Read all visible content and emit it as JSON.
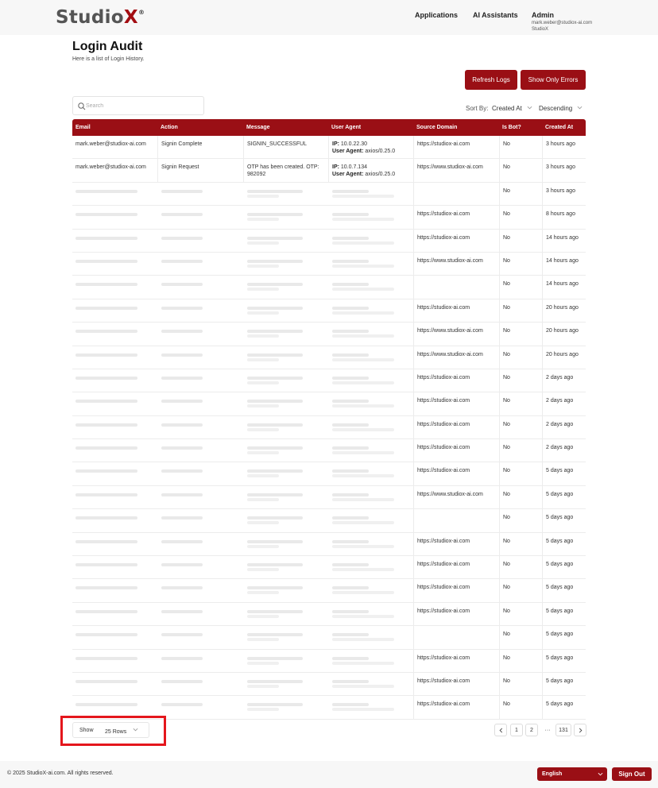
{
  "header": {
    "logo_main": "Studio",
    "logo_accent": "X",
    "logo_mark": "®",
    "nav": [
      {
        "label": "Applications"
      },
      {
        "label": "AI Assistants"
      }
    ],
    "user": {
      "name": "Admin",
      "email": "mark.weber@studiox-ai.com",
      "org": "StudioX"
    }
  },
  "page": {
    "title": "Login Audit",
    "subtitle": "Here is a list of Login History."
  },
  "toolbar": {
    "refresh_label": "Refresh Logs",
    "errors_label": "Show Only Errors",
    "search_placeholder": "Search",
    "sort_by_label": "Sort By:",
    "sort_field": "Created At",
    "sort_direction": "Descending"
  },
  "table": {
    "columns": [
      "Email",
      "Action",
      "Message",
      "User Agent",
      "Source Domain",
      "Is Bot?",
      "Created At"
    ],
    "rows": [
      {
        "email": "mark.weber@studiox-ai.com",
        "action": "Signin Complete",
        "message": "SIGNIN_SUCCESSFUL",
        "ip_label": "IP:",
        "ip": " 10.0.22.30",
        "ua_label": "User Agent:",
        "ua": " axios/0.25.0",
        "domain": "https://studiox-ai.com",
        "bot": "No",
        "created": "3 hours ago",
        "blurred": false
      },
      {
        "email": "mark.weber@studiox-ai.com",
        "action": "Signin Request",
        "message": "OTP has been created. OTP: 982092",
        "ip_label": "IP:",
        "ip": " 10.0.7.134",
        "ua_label": "User Agent:",
        "ua": " axios/0.25.0",
        "domain": "https://www.studiox-ai.com",
        "bot": "No",
        "created": "3 hours ago",
        "blurred": false
      },
      {
        "domain": "",
        "bot": "No",
        "created": "3 hours ago",
        "blurred": true
      },
      {
        "domain": "https://studiox-ai.com",
        "bot": "No",
        "created": "8 hours ago",
        "blurred": true
      },
      {
        "domain": "https://studiox-ai.com",
        "bot": "No",
        "created": "14 hours ago",
        "blurred": true
      },
      {
        "domain": "https://www.studiox-ai.com",
        "bot": "No",
        "created": "14 hours ago",
        "blurred": true
      },
      {
        "domain": "",
        "bot": "No",
        "created": "14 hours ago",
        "blurred": true
      },
      {
        "domain": "https://studiox-ai.com",
        "bot": "No",
        "created": "20 hours ago",
        "blurred": true
      },
      {
        "domain": "https://www.studiox-ai.com",
        "bot": "No",
        "created": "20 hours ago",
        "blurred": true
      },
      {
        "domain": "https://www.studiox-ai.com",
        "bot": "No",
        "created": "20 hours ago",
        "blurred": true
      },
      {
        "domain": "https://studiox-ai.com",
        "bot": "No",
        "created": "2 days ago",
        "blurred": true
      },
      {
        "domain": "https://studiox-ai.com",
        "bot": "No",
        "created": "2 days ago",
        "blurred": true
      },
      {
        "domain": "https://studiox-ai.com",
        "bot": "No",
        "created": "2 days ago",
        "blurred": true
      },
      {
        "domain": "https://studiox-ai.com",
        "bot": "No",
        "created": "2 days ago",
        "blurred": true
      },
      {
        "domain": "https://studiox-ai.com",
        "bot": "No",
        "created": "5 days ago",
        "blurred": true
      },
      {
        "domain": "https://www.studiox-ai.com",
        "bot": "No",
        "created": "5 days ago",
        "blurred": true
      },
      {
        "domain": "",
        "bot": "No",
        "created": "5 days ago",
        "blurred": true
      },
      {
        "domain": "https://studiox-ai.com",
        "bot": "No",
        "created": "5 days ago",
        "blurred": true
      },
      {
        "domain": "https://studiox-ai.com",
        "bot": "No",
        "created": "5 days ago",
        "blurred": true
      },
      {
        "domain": "https://studiox-ai.com",
        "bot": "No",
        "created": "5 days ago",
        "blurred": true
      },
      {
        "domain": "https://studiox-ai.com",
        "bot": "No",
        "created": "5 days ago",
        "blurred": true
      },
      {
        "domain": "",
        "bot": "No",
        "created": "5 days ago",
        "blurred": true
      },
      {
        "domain": "https://studiox-ai.com",
        "bot": "No",
        "created": "5 days ago",
        "blurred": true
      },
      {
        "domain": "https://studiox-ai.com",
        "bot": "No",
        "created": "5 days ago",
        "blurred": true
      },
      {
        "domain": "https://studiox-ai.com",
        "bot": "No",
        "created": "5 days ago",
        "blurred": true
      }
    ]
  },
  "pagination": {
    "show_label": "Show",
    "rows_selected": "25 Rows",
    "pages": [
      "1",
      "2"
    ],
    "ellipsis": "···",
    "last_page": "131"
  },
  "footer": {
    "copyright": "© 2025 StudioX-ai.com.  All rights reserved.",
    "language": "English",
    "signout_label": "Sign Out"
  },
  "colors": {
    "accent": "#9a0f15",
    "highlight": "#e4161c"
  }
}
